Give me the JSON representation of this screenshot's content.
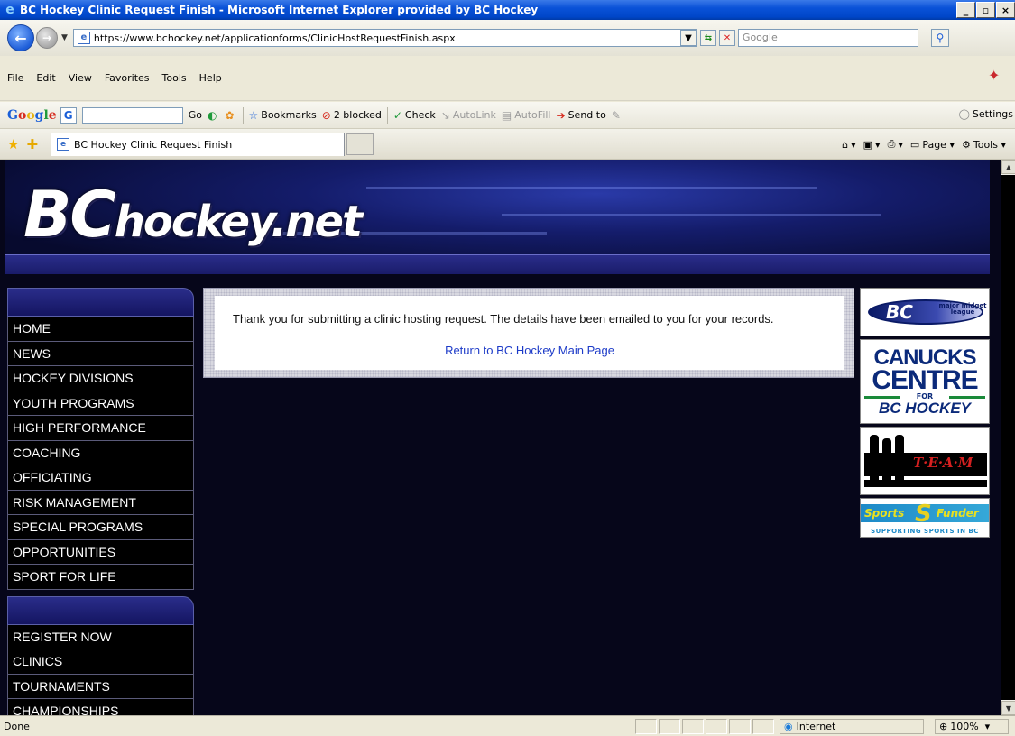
{
  "window": {
    "title": "BC Hockey Clinic Request Finish - Microsoft Internet Explorer provided by BC Hockey",
    "minimize": "_",
    "maximize": "▫",
    "close": "×"
  },
  "address": {
    "url": "https://www.bchockey.net/applicationforms/ClinicHostRequestFinish.aspx",
    "search_placeholder": "Google"
  },
  "menu": {
    "items": [
      {
        "label": "File"
      },
      {
        "label": "Edit"
      },
      {
        "label": "View"
      },
      {
        "label": "Favorites"
      },
      {
        "label": "Tools"
      },
      {
        "label": "Help"
      }
    ]
  },
  "google_toolbar": {
    "go": "Go",
    "bookmarks": "Bookmarks",
    "blocked": "2 blocked",
    "check": "Check",
    "autolink": "AutoLink",
    "autofill": "AutoFill",
    "send_to": "Send to",
    "settings": "Settings"
  },
  "tabs": {
    "active_label": "BC Hockey Clinic Request Finish"
  },
  "command_bar": {
    "page": "Page",
    "tools": "Tools"
  },
  "site": {
    "logo_bc": "BC",
    "logo_rest": "hockey.net",
    "nav_primary": [
      "HOME",
      "NEWS",
      "HOCKEY DIVISIONS",
      "YOUTH PROGRAMS",
      "HIGH PERFORMANCE",
      "COACHING",
      "OFFICIATING",
      "RISK MANAGEMENT",
      "SPECIAL PROGRAMS",
      "OPPORTUNITIES",
      "SPORT FOR LIFE"
    ],
    "nav_secondary": [
      "REGISTER NOW",
      "CLINICS",
      "TOURNAMENTS",
      "CHAMPIONSHIPS"
    ],
    "message": "Thank you for submitting a clinic hosting request. The details have been emailed to you for your records.",
    "return_link": "Return to BC Hockey Main Page",
    "sponsors": {
      "bc_league_mark": "BC",
      "bc_league_small": "major midget league",
      "canucks_line1": "CANUCKS",
      "canucks_line2": "CENTRE",
      "canucks_for": "FOR",
      "canucks_line4": "BC HOCKEY",
      "team_text": "T·E·A·M",
      "sports_word1": "Sports",
      "sports_word2": "Funder",
      "sports_tag": "SUPPORTING SPORTS IN BC"
    }
  },
  "status": {
    "text": "Done",
    "zone": "Internet",
    "zoom": "100%"
  },
  "colors": {
    "nav_bg": "#000000",
    "link": "#1d3bc8",
    "banner": "#141c6a"
  }
}
